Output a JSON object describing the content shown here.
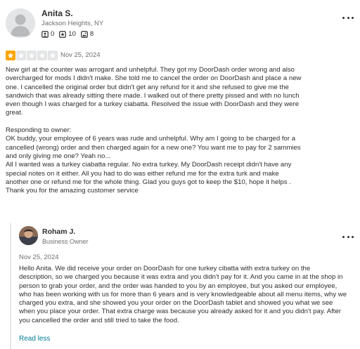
{
  "reviewer": {
    "name": "Anita S.",
    "location": "Jackson Heights, NY",
    "stats": {
      "friends": "0",
      "reviews": "10",
      "photos": "8"
    }
  },
  "review": {
    "rating": 1,
    "max_rating": 5,
    "star_color_active": "#fea500",
    "star_color_inactive": "#e4e5e7",
    "date": "Nov 25, 2024",
    "text": "New girl at the counter was arrogant and unhelpful. They got my DoorDash order wrong and also\novercharged for mods I didn't make. She told me to cancel the order on DoorDash and place a new\none. I cancelled the original order but didn't get any refund for it and she refused to give me the\nsandwich that was already sitting there made. I walked out of there pretty pissed and with no lunch\neven though I was charged for a turkey ciabatta. Resolved the issue with DoorDash and they were\ngreat.\n\nResponding to owner:\nOK buddy, your employee of 6 years was rude and unhelpful. Why am I going to be charged for a\ncancelled (wrong) order and then charged again for a new one? You want me to pay for 2 sammies\nand only giving me one? Yeah no...\nAll I wanted was a turkey ciabatta regular. No extra turkey. My DoorDash receipt didn't have any\nspecial notes on it either. All you had to do was either refund me for the extra turk and make\nanother one or refund me for the whole thing. Glad you guys got to keep the $10, hope it helps .\nThank you for the amazing customer service"
  },
  "owner_reply": {
    "name": "Roham J.",
    "role": "Business Owner",
    "date": "Nov 25, 2024",
    "text": "Hello Anita. We did receive your order on DoorDash for one turkey cibatta with extra turkey on the\ndescription, so we charged you because it was extra and you didn't pay for it. And you came in at the shop in\nperson to grab your order, and the order was handed to you by an employee, but you asked our employee,\nwho has been working with us for more than 6 years and is very knowledgeable about all menu items, why we\ncharged you extra, and she showed you your order on the DoorDash tablet and showed you what we see\nwhen you place your order. That extra charge was because you already asked for it and you didn't pay. After\nyou cancelled the order and still tried to take the food.",
    "read_less_label": "Read less"
  },
  "colors": {
    "link": "#027a97",
    "text": "#2d2e2f",
    "muted": "#6e7072"
  },
  "icons": {
    "friends": "friends-icon",
    "reviews": "review-star-icon",
    "photos": "photo-icon",
    "more": "more-options-icon"
  }
}
